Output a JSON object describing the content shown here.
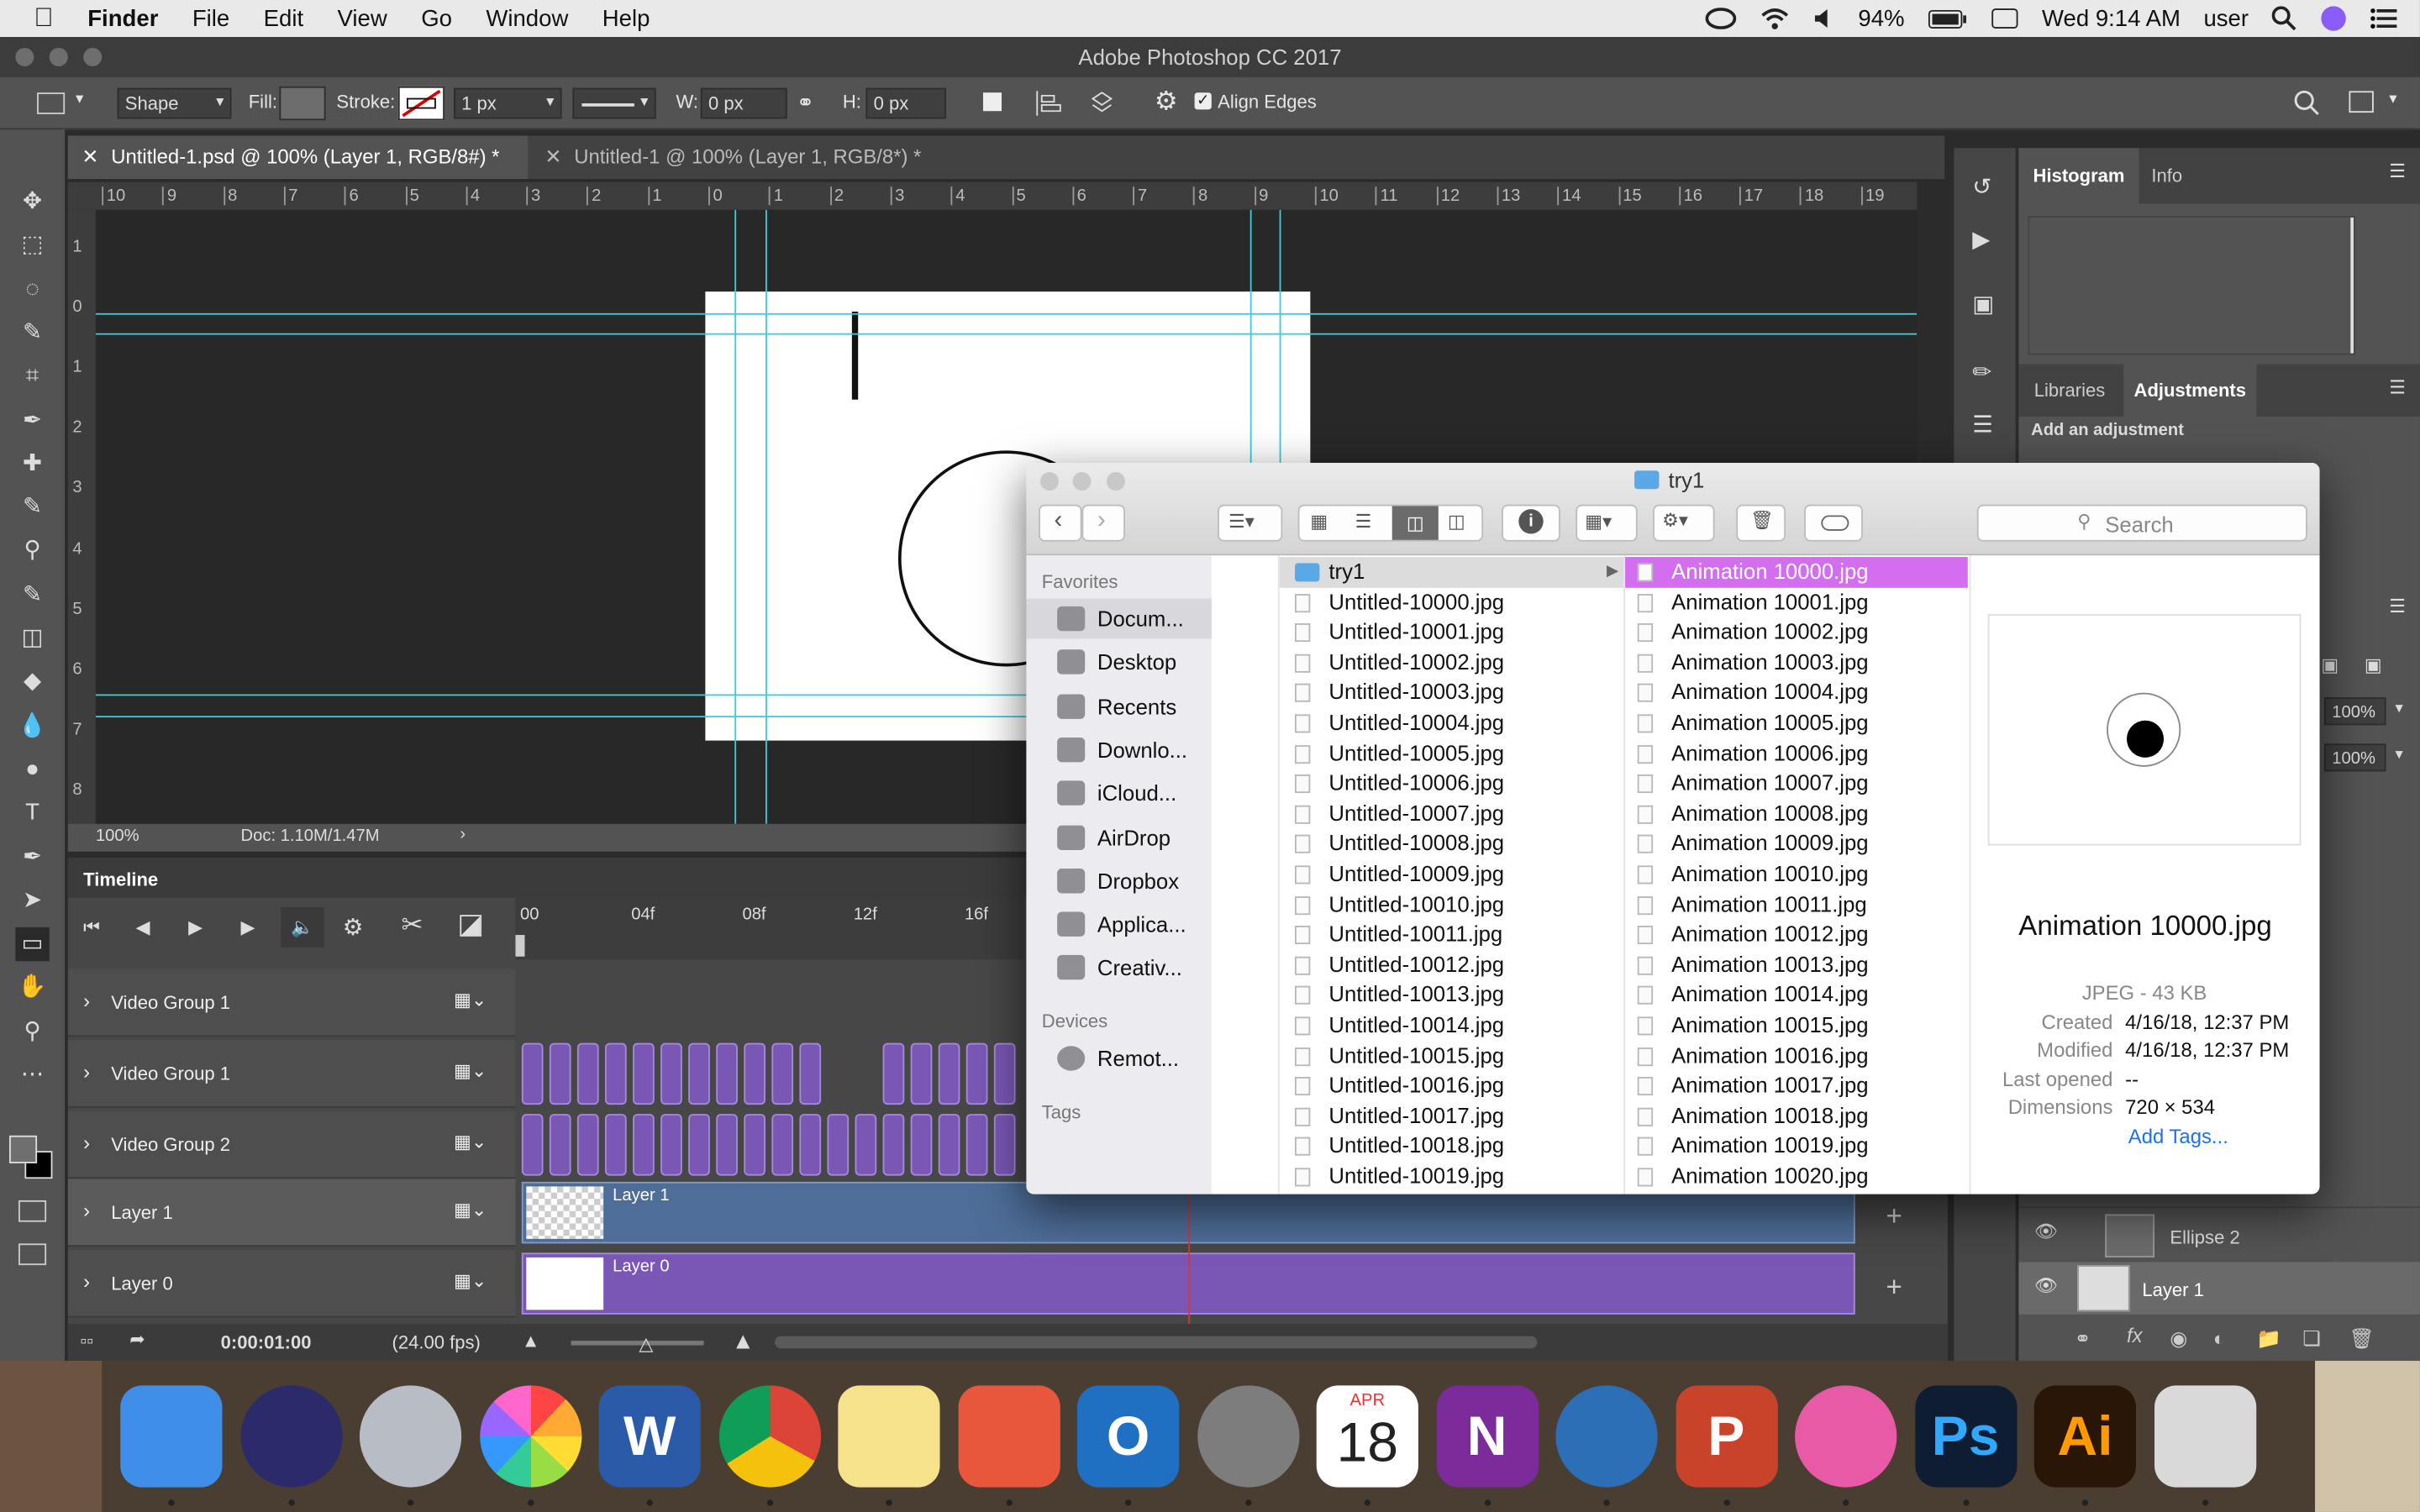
{
  "menubar": {
    "app": "Finder",
    "items": [
      "File",
      "Edit",
      "View",
      "Go",
      "Window",
      "Help"
    ],
    "battery": "94%",
    "clock": "Wed 9:14 AM",
    "user": "user"
  },
  "window_title": "Adobe Photoshop CC 2017",
  "options": {
    "tool_mode": "Shape",
    "fill_label": "Fill:",
    "stroke_label": "Stroke:",
    "stroke_width": "1 px",
    "w_label": "W:",
    "w_value": "0 px",
    "h_label": "H:",
    "h_value": "0 px",
    "align_edges": "Align Edges"
  },
  "doc_tabs": [
    {
      "label": "Untitled-1.psd @ 100% (Layer 1, RGB/8#) *"
    },
    {
      "label": "Untitled-1 @ 100% (Layer 1, RGB/8*) *"
    }
  ],
  "ruler": {
    "h": [
      "10",
      "9",
      "8",
      "7",
      "6",
      "5",
      "4",
      "3",
      "2",
      "1",
      "0",
      "1",
      "2",
      "3",
      "4",
      "5",
      "6",
      "7",
      "8",
      "9",
      "10",
      "11",
      "12",
      "13",
      "14",
      "15",
      "16",
      "17",
      "18",
      "19"
    ],
    "v": [
      "1",
      "0",
      "1",
      "2",
      "3",
      "4",
      "5",
      "6",
      "7",
      "8"
    ]
  },
  "status": {
    "zoom": "100%",
    "doc": "Doc: 1.10M/1.47M"
  },
  "timeline": {
    "title": "Timeline",
    "ruler": [
      "00",
      "04f",
      "08f",
      "12f",
      "16f"
    ],
    "tracks": [
      "Video Group 1",
      "Video Group 1",
      "Video Group 2",
      "Layer 1",
      "Layer 0"
    ],
    "clip_labels": [
      "Layer 1",
      "Layer 0"
    ],
    "timecode": "0:00:01:00",
    "fps": "(24.00 fps)"
  },
  "right_panel": {
    "tabs1": [
      "Histogram",
      "Info"
    ],
    "tabs2": [
      "Libraries",
      "Adjustments"
    ],
    "adjust_label": "Add an adjustment",
    "opacity": "100%",
    "fill": "100%",
    "layers": [
      "Ellipse 2",
      "Layer 1"
    ]
  },
  "finder": {
    "title": "try1",
    "search_placeholder": "Search",
    "favorites_label": "Favorites",
    "favorites": [
      "Docum...",
      "Desktop",
      "Recents",
      "Downlo...",
      "iCloud...",
      "AirDrop",
      "Dropbox",
      "Applica...",
      "Creativ..."
    ],
    "devices_label": "Devices",
    "devices": [
      "Remot..."
    ],
    "tags_label": "Tags",
    "col1": [
      "try1",
      "Untitled-10000.jpg",
      "Untitled-10001.jpg",
      "Untitled-10002.jpg",
      "Untitled-10003.jpg",
      "Untitled-10004.jpg",
      "Untitled-10005.jpg",
      "Untitled-10006.jpg",
      "Untitled-10007.jpg",
      "Untitled-10008.jpg",
      "Untitled-10009.jpg",
      "Untitled-10010.jpg",
      "Untitled-10011.jpg",
      "Untitled-10012.jpg",
      "Untitled-10013.jpg",
      "Untitled-10014.jpg",
      "Untitled-10015.jpg",
      "Untitled-10016.jpg",
      "Untitled-10017.jpg",
      "Untitled-10018.jpg",
      "Untitled-10019.jpg"
    ],
    "col2": [
      "Animation 10000.jpg",
      "Animation 10001.jpg",
      "Animation 10002.jpg",
      "Animation 10003.jpg",
      "Animation 10004.jpg",
      "Animation 10005.jpg",
      "Animation 10006.jpg",
      "Animation 10007.jpg",
      "Animation 10008.jpg",
      "Animation 10009.jpg",
      "Animation 10010.jpg",
      "Animation 10011.jpg",
      "Animation 10012.jpg",
      "Animation 10013.jpg",
      "Animation 10014.jpg",
      "Animation 10015.jpg",
      "Animation 10016.jpg",
      "Animation 10017.jpg",
      "Animation 10018.jpg",
      "Animation 10019.jpg",
      "Animation 10020.jpg"
    ],
    "preview": {
      "name": "Animation 10000.jpg",
      "kind": "JPEG - 43 KB",
      "created_label": "Created",
      "created": "4/16/18, 12:37 PM",
      "modified_label": "Modified",
      "modified": "4/16/18, 12:37 PM",
      "opened_label": "Last opened",
      "opened": "--",
      "dims_label": "Dimensions",
      "dims": "720 × 534",
      "add_tags": "Add Tags..."
    }
  },
  "dock": {
    "calendar_month": "APR",
    "calendar_day": "18",
    "apps": [
      "finder-icon",
      "siri-icon",
      "launchpad-icon",
      "photos-icon",
      "word-icon",
      "chrome-icon",
      "stickies-icon",
      "pinpoint-icon",
      "outlook-icon",
      "system-preferences-icon",
      "calendar-icon",
      "onenote-icon",
      "quicktime-icon",
      "powerpoint-icon",
      "itunes-icon",
      "photoshop-icon",
      "illustrator-icon",
      "trash-icon"
    ],
    "ps_label": "Ps",
    "ai_label": "Ai",
    "word_label": "W",
    "ppt_label": "P",
    "onenote_label": "N",
    "outlook_label": "O"
  },
  "colors": {
    "accent": "#d36ef0",
    "timeline_clip": "#7a57b5",
    "layer1_bar": "#4e6d98"
  }
}
